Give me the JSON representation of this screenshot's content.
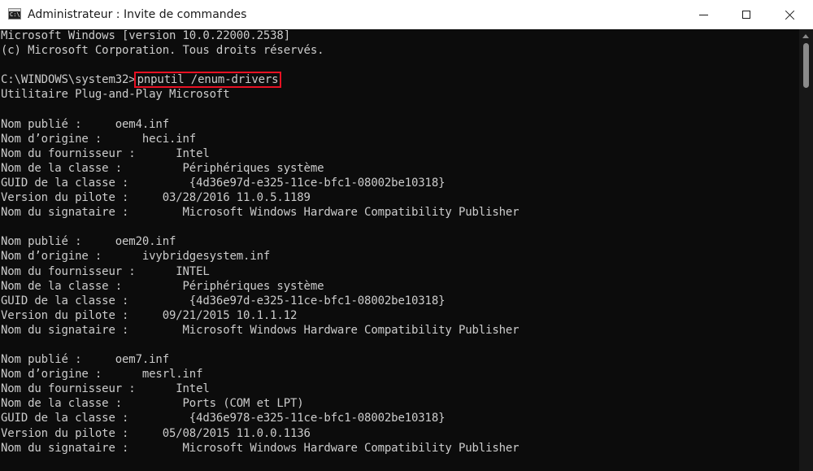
{
  "window": {
    "title": "Administrateur : Invite de commandes",
    "icon_glyph": "C:\\."
  },
  "console_lines": [
    "Microsoft Windows [version 10.0.22000.2538]",
    "(c) Microsoft Corporation. Tous droits réservés.",
    "",
    "__PROMPT__",
    "Utilitaire Plug-and-Play Microsoft",
    "",
    "Nom publié :     oem4.inf",
    "Nom d’origine :      heci.inf",
    "Nom du fournisseur :      Intel",
    "Nom de la classe :         Périphériques système",
    "GUID de la classe :         {4d36e97d-e325-11ce-bfc1-08002be10318}",
    "Version du pilote :     03/28/2016 11.0.5.1189",
    "Nom du signataire :        Microsoft Windows Hardware Compatibility Publisher",
    "",
    "Nom publié :     oem20.inf",
    "Nom d’origine :      ivybridgesystem.inf",
    "Nom du fournisseur :      INTEL",
    "Nom de la classe :         Périphériques système",
    "GUID de la classe :         {4d36e97d-e325-11ce-bfc1-08002be10318}",
    "Version du pilote :     09/21/2015 10.1.1.12",
    "Nom du signataire :        Microsoft Windows Hardware Compatibility Publisher",
    "",
    "Nom publié :     oem7.inf",
    "Nom d’origine :      mesrl.inf",
    "Nom du fournisseur :      Intel",
    "Nom de la classe :         Ports (COM et LPT)",
    "GUID de la classe :         {4d36e978-e325-11ce-bfc1-08002be10318}",
    "Version du pilote :     05/08/2015 11.0.0.1136",
    "Nom du signataire :        Microsoft Windows Hardware Compatibility Publisher"
  ],
  "prompt": {
    "path": "C:\\WINDOWS\\system32>",
    "command": "pnputil /enum-drivers"
  },
  "colors": {
    "console_bg": "#0c0c0c",
    "console_text": "#cccccc",
    "highlight": "#e81123"
  },
  "icons": {
    "minimize": "minimize-icon",
    "maximize": "maximize-icon",
    "close": "close-icon",
    "app": "cmd-app-icon"
  }
}
